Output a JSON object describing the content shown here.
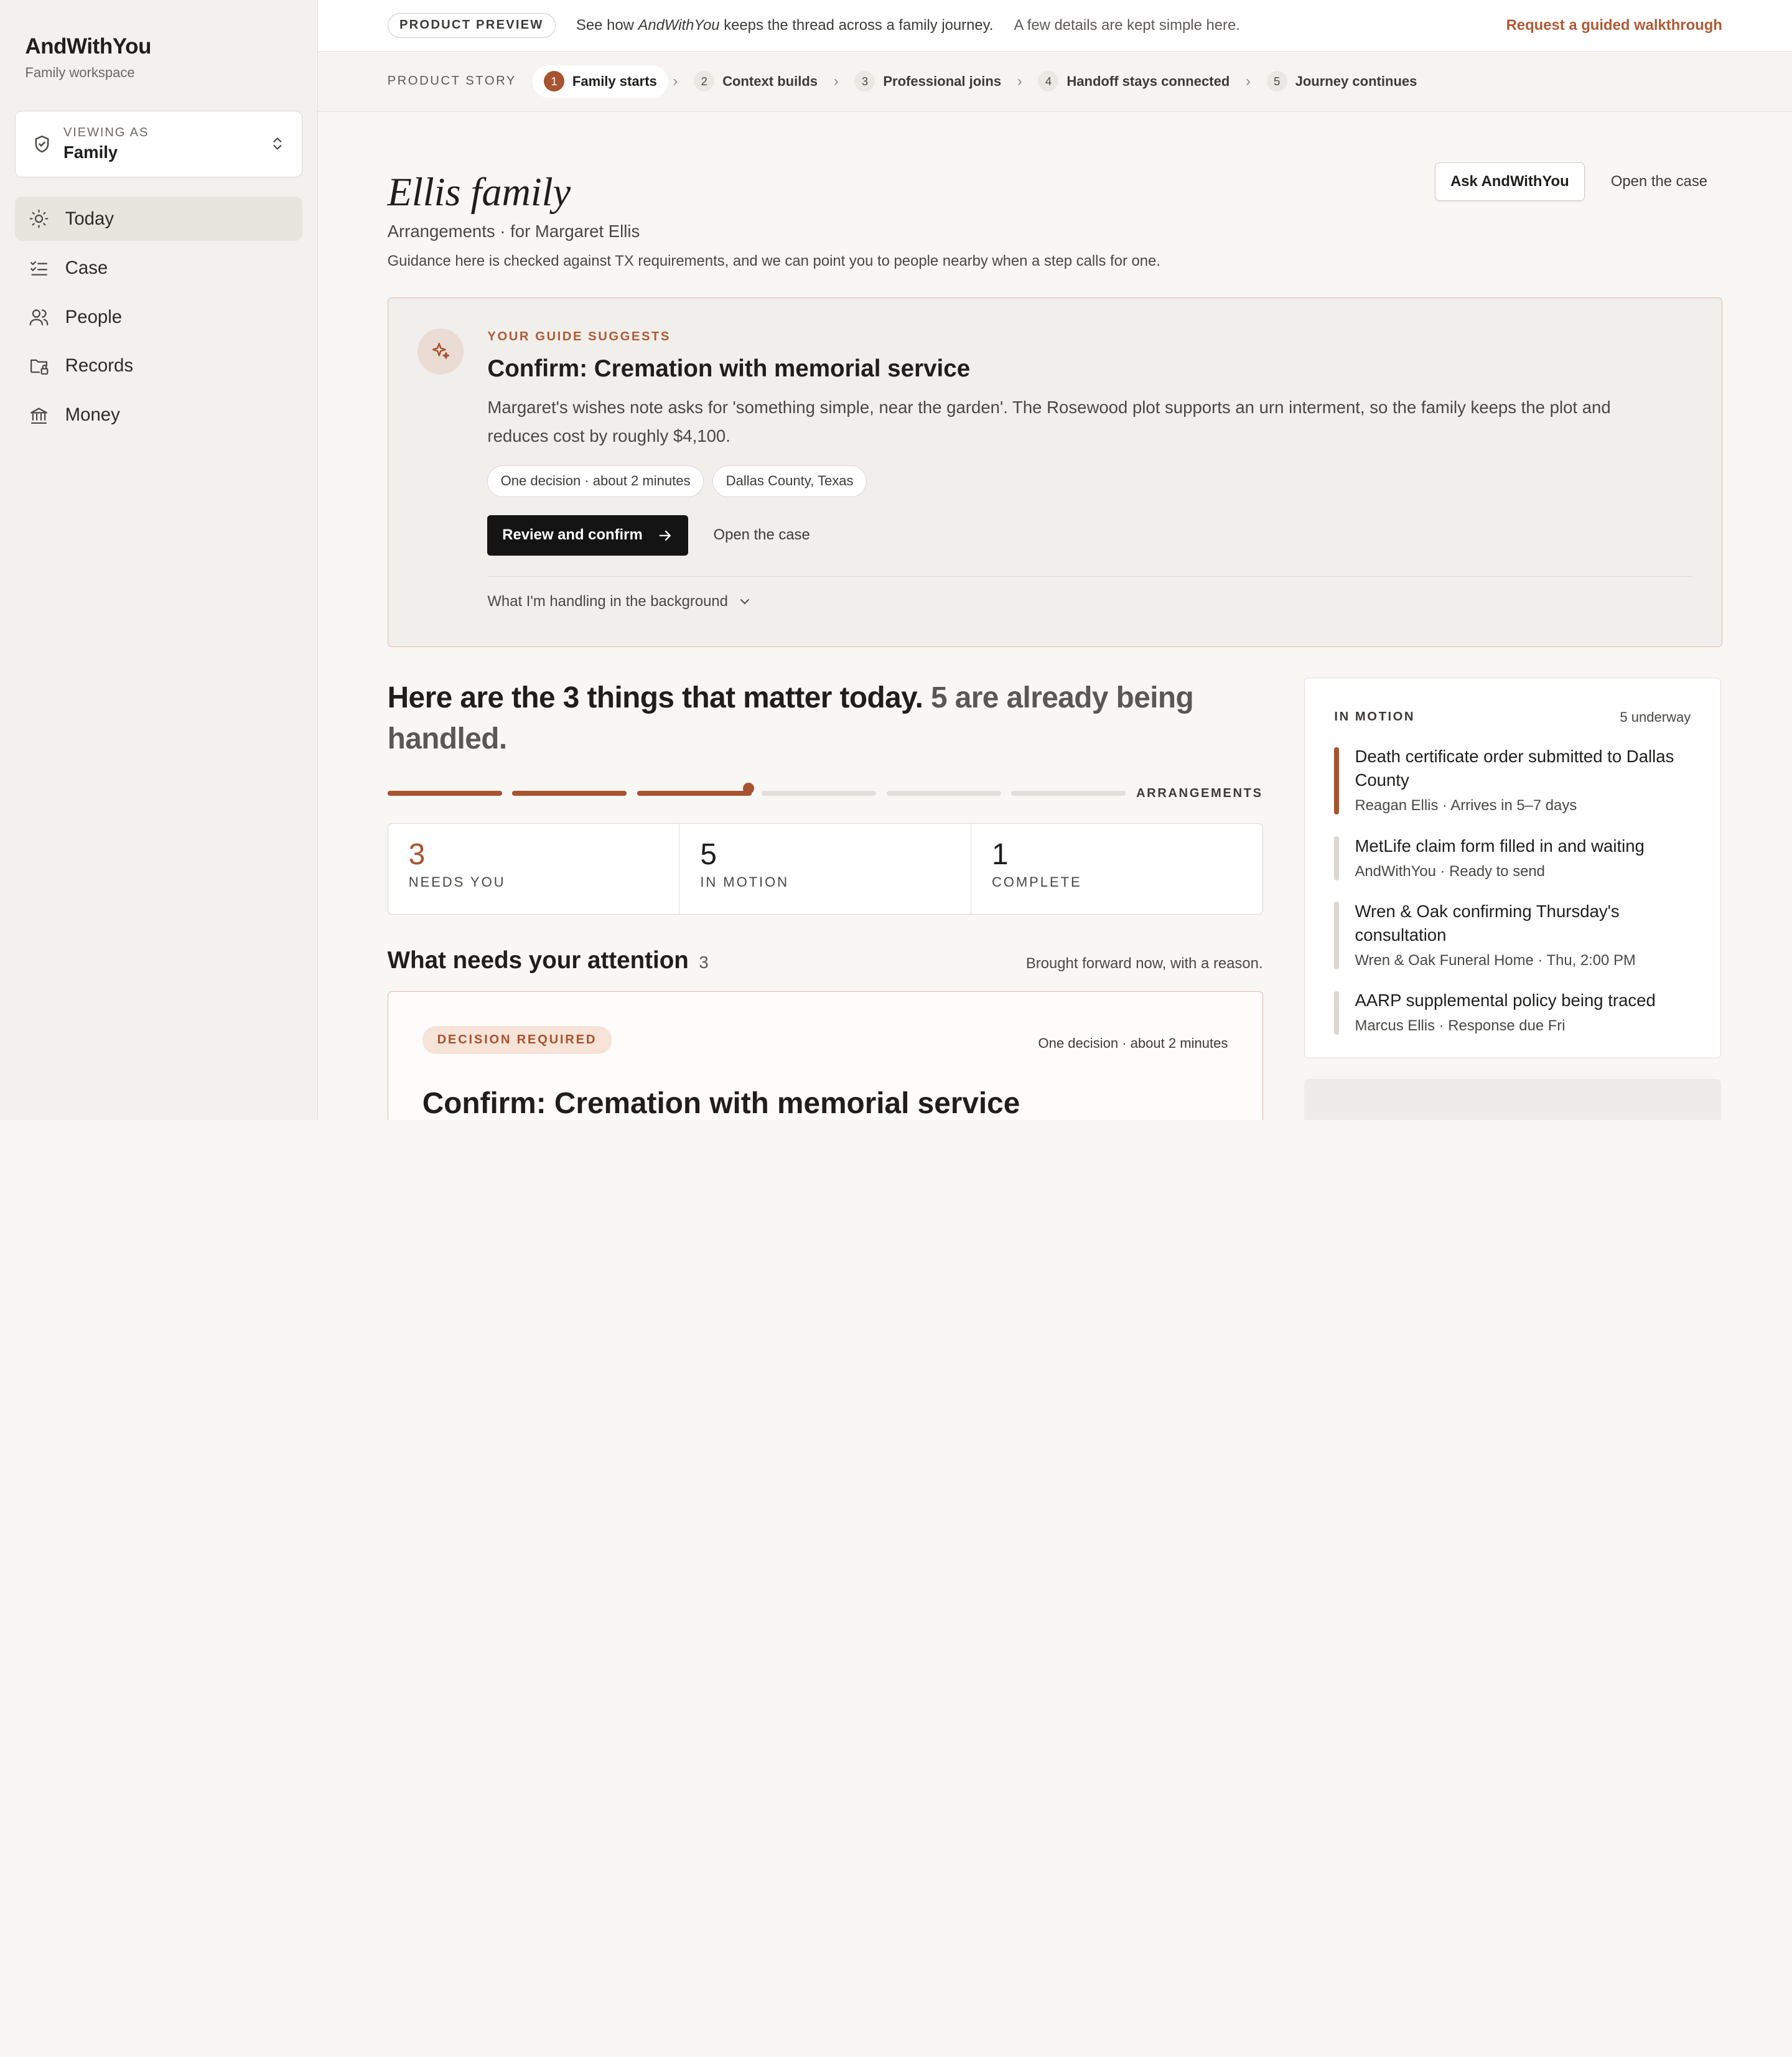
{
  "sidebar": {
    "brand": "AndWithYou",
    "brand_sub": "Family workspace",
    "viewer_label": "VIEWING AS",
    "viewer_value": "Family",
    "items": [
      {
        "label": "Today",
        "icon": "sun-icon",
        "active": true
      },
      {
        "label": "Case",
        "icon": "checklist-icon"
      },
      {
        "label": "People",
        "icon": "people-icon"
      },
      {
        "label": "Records",
        "icon": "folder-lock-icon"
      },
      {
        "label": "Money",
        "icon": "bank-icon"
      }
    ]
  },
  "banner": {
    "pill": "PRODUCT PREVIEW",
    "text_pre": "See how ",
    "text_brand": "AndWithYou",
    "text_post": " keeps the thread across a family journey.",
    "muted": "A few details are kept simple here.",
    "link": "Request a guided walkthrough"
  },
  "story": {
    "label": "PRODUCT STORY",
    "steps": [
      {
        "num": "1",
        "label": "Family starts"
      },
      {
        "num": "2",
        "label": "Context builds"
      },
      {
        "num": "3",
        "label": "Professional joins"
      },
      {
        "num": "4",
        "label": "Handoff stays connected"
      },
      {
        "num": "5",
        "label": "Journey continues"
      }
    ]
  },
  "header": {
    "title": "Ellis family",
    "subtitle": "Arrangements · for Margaret Ellis",
    "description": "Guidance here is checked against TX requirements, and we can point you to people nearby when a step calls for one.",
    "ask_button": "Ask AndWithYou",
    "open_button": "Open the case"
  },
  "guide": {
    "kicker": "YOUR GUIDE SUGGESTS",
    "title": "Confirm: Cremation with memorial service",
    "body": "Margaret's wishes note asks for 'something simple, near the garden'. The Rosewood plot supports an urn interment, so the family keeps the plot and reduces cost by roughly $4,100.",
    "chips": [
      "One decision · about 2 minutes",
      "Dallas County, Texas"
    ],
    "primary": "Review and confirm",
    "secondary": "Open the case",
    "background": "What I'm handling in the background"
  },
  "today": {
    "head_main": "Here are the 3 things that matter today.",
    "head_muted": "5 are already being handled.",
    "progress_label": "ARRANGEMENTS",
    "progress_filled": 3,
    "progress_total": 6,
    "stats": [
      {
        "num": "3",
        "label": "NEEDS YOU"
      },
      {
        "num": "5",
        "label": "IN MOTION"
      },
      {
        "num": "1",
        "label": "COMPLETE"
      }
    ]
  },
  "attention": {
    "title": "What needs your attention",
    "count": "3",
    "note": "Brought forward now, with a reason.",
    "card": {
      "badge": "DECISION REQUIRED",
      "meta": "One decision · about 2 minutes",
      "title": "Confirm: Cremation with memorial service"
    }
  },
  "motion": {
    "label": "IN MOTION",
    "count": "5 underway",
    "items": [
      {
        "title": "Death certificate order submitted to Dallas County",
        "sub": "Reagan Ellis · Arrives in 5–7 days"
      },
      {
        "title": "MetLife claim form filled in and waiting",
        "sub": "AndWithYou · Ready to send"
      },
      {
        "title": "Wren & Oak confirming Thursday's consultation",
        "sub": "Wren & Oak Funeral Home · Thu, 2:00 PM"
      },
      {
        "title": "AARP supplemental policy being traced",
        "sub": "Marcus Ellis · Response due Fri"
      }
    ]
  },
  "colors": {
    "accent": "#a8532f",
    "dark_button": "#141414",
    "sidebar_bg": "#f2f1ee"
  }
}
